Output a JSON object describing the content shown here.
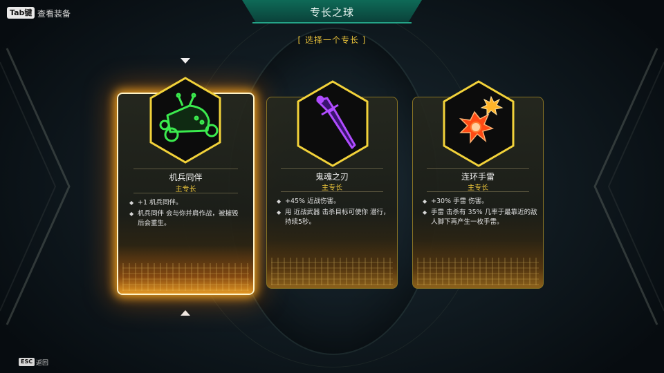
{
  "hud": {
    "tab_key": "Tab键",
    "tab_hint": "查看装备",
    "esc_key": "ESC",
    "esc_hint": "返回"
  },
  "header": {
    "title": "专长之球",
    "subtitle": "[ 选择一个专长 ]"
  },
  "cards": [
    {
      "name": "机兵同伴",
      "tag": "主专长",
      "icon": "robot-companion-icon",
      "icon_color": "#38e04a",
      "selected": true,
      "bullets": [
        "+1 机兵同伴。",
        "机兵同伴 会与你并肩作战，被摧毁",
        "后会重生。"
      ]
    },
    {
      "name": "鬼魂之刃",
      "tag": "主专长",
      "icon": "ghost-dagger-icon",
      "icon_color": "#9a3cf0",
      "selected": false,
      "bullets": [
        "+45% 近战伤害。",
        "用 近战武器 击杀目标可使你 潜行，",
        "持续5秒。"
      ]
    },
    {
      "name": "连环手雷",
      "tag": "主专长",
      "icon": "grenade-explosion-icon",
      "icon_color": "#ff5a1e",
      "selected": false,
      "bullets": [
        "+30% 手雷 伤害。",
        "手雷 击杀有 35% 几率于最靠近的敌",
        "人脚下再产生一枚手雷。"
      ]
    }
  ],
  "colors": {
    "accent_gold": "#e9c23a",
    "title_green": "#0e6a57",
    "card_border": "#8a7424"
  }
}
